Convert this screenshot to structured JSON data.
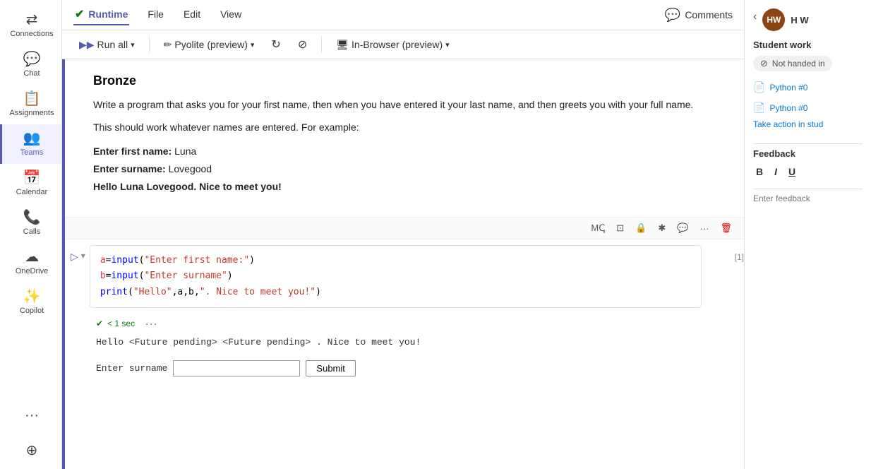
{
  "sidebar": {
    "items": [
      {
        "id": "connections",
        "label": "Connections",
        "icon": "⇄",
        "active": false
      },
      {
        "id": "chat",
        "label": "Chat",
        "icon": "💬",
        "active": false
      },
      {
        "id": "assignments",
        "label": "Assignments",
        "icon": "📋",
        "active": false
      },
      {
        "id": "teams",
        "label": "Teams",
        "icon": "👥",
        "active": true
      },
      {
        "id": "calendar",
        "label": "Calendar",
        "icon": "📅",
        "active": false
      },
      {
        "id": "calls",
        "label": "Calls",
        "icon": "📞",
        "active": false
      },
      {
        "id": "onedrive",
        "label": "OneDrive",
        "icon": "☁",
        "active": false
      },
      {
        "id": "copilot",
        "label": "Copilot",
        "icon": "✨",
        "active": false
      }
    ],
    "more_label": "...",
    "add_label": "+"
  },
  "menubar": {
    "items": [
      {
        "id": "runtime",
        "label": "Runtime",
        "active": true
      },
      {
        "id": "file",
        "label": "File",
        "active": false
      },
      {
        "id": "edit",
        "label": "Edit",
        "active": false
      },
      {
        "id": "view",
        "label": "View",
        "active": false
      }
    ],
    "comments_label": "Comments"
  },
  "toolbar": {
    "run_all_label": "Run all",
    "pyolite_label": "Pyolite (preview)",
    "inbrowser_label": "In-Browser (preview)"
  },
  "notebook": {
    "markdown_title": "Bronze",
    "markdown_para1": "Write a program that asks you for your first name, then when you have entered it your last name, and then greets you with your full name.",
    "markdown_para2": "This should work whatever names are entered. For example:",
    "example_line1_label": "Enter first name:",
    "example_line1_value": "Luna",
    "example_line2_label": "Enter surname:",
    "example_line2_value": "Lovegood",
    "example_line3": "Hello Luna Lovegood. Nice to meet you!",
    "code_line1": "a=input(\"Enter first name:\")",
    "code_line2": "b=input(\"Enter surname\")",
    "code_line3": "print(\"Hello\",a,b,\". Nice to meet you!\")",
    "cell_number": "[1]",
    "cell_time": "< 1 sec",
    "output_line": "Hello <Future pending> <Future pending> . Nice to meet you!",
    "input_label": "Enter surname",
    "submit_label": "Submit",
    "more_dots": "···"
  },
  "right_panel": {
    "user_initials": "HW",
    "username": "H W",
    "student_work_label": "Student work",
    "not_handed_label": "Not handed in",
    "file1_label": "Python #0",
    "file2_label": "Python #0",
    "take_action_label": "Take action in stud",
    "feedback_label": "Feedback",
    "bold_label": "B",
    "italic_label": "I",
    "underline_label": "U",
    "feedback_placeholder": "Enter feedback"
  },
  "colors": {
    "accent": "#5558af",
    "active_border": "#5558af",
    "green": "#107c10",
    "link": "#0078d4"
  }
}
